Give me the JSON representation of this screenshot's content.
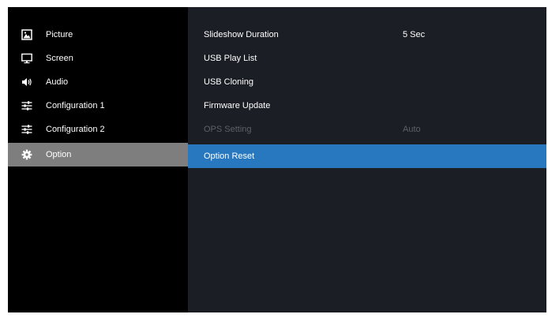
{
  "sidebar": {
    "items": [
      {
        "label": "Picture",
        "icon": "picture-icon"
      },
      {
        "label": "Screen",
        "icon": "monitor-icon"
      },
      {
        "label": "Audio",
        "icon": "speaker-icon"
      },
      {
        "label": "Configuration 1",
        "icon": "sliders-icon"
      },
      {
        "label": "Configuration 2",
        "icon": "sliders-icon"
      },
      {
        "label": "Option",
        "icon": "gear-icon",
        "selected": true
      }
    ]
  },
  "option_menu": {
    "rows": [
      {
        "label": "Slideshow Duration",
        "value": "5 Sec"
      },
      {
        "label": "USB Play List",
        "value": ""
      },
      {
        "label": "USB Cloning",
        "value": ""
      },
      {
        "label": "Firmware Update",
        "value": ""
      },
      {
        "label": "OPS Setting",
        "value": "Auto",
        "disabled": true
      },
      {
        "label": "Option Reset",
        "value": "",
        "highlighted": true
      }
    ]
  },
  "colors": {
    "sidebar_bg": "#000000",
    "content_bg": "#1b1e25",
    "sidebar_selected": "#7e7e7e",
    "row_highlight": "#2878c0",
    "text": "#ffffff",
    "text_disabled": "#5e6068"
  }
}
